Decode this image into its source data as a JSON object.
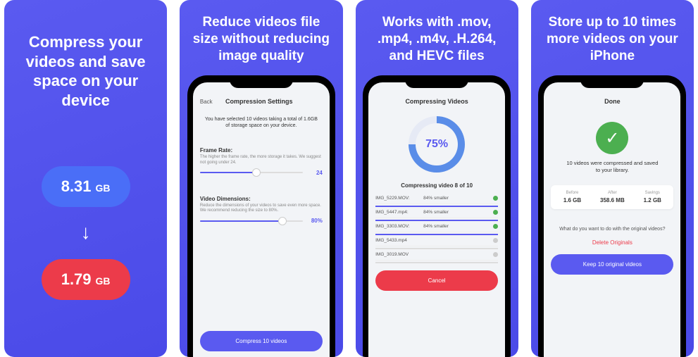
{
  "panel1": {
    "headline": "Compress your videos and save space on your device",
    "before_value": "8.31",
    "before_unit": "GB",
    "after_value": "1.79",
    "after_unit": "GB"
  },
  "panel2": {
    "headline": "Reduce videos file size without reducing image quality",
    "nav_back": "Back",
    "nav_title": "Compression Settings",
    "intro": "You have selected 10 videos taking a total of 1.6GB of storage space on your device.",
    "framerate_label": "Frame Rate:",
    "framerate_hint": "The higher the frame rate, the more storage it takes. We suggest not going under 24.",
    "framerate_value": "24",
    "dimensions_label": "Video Dimensions:",
    "dimensions_hint": "Reduce the dimensions of your videos to save even more space. We recommend reducing the size to 80%.",
    "dimensions_value": "80%",
    "cta": "Compress 10 videos"
  },
  "panel3": {
    "headline": "Works with .mov, .mp4, .m4v, .H.264, and HEVC files",
    "nav_title": "Compressing Videos",
    "progress_pct": "75%",
    "sub_label": "Compressing video 8 of 10",
    "rows": [
      {
        "name": "IMG_5229.MOV:",
        "stat": "84% smaller",
        "done": true
      },
      {
        "name": "IMG_5447.mp4:",
        "stat": "84% smaller",
        "done": true
      },
      {
        "name": "IMG_3303.MOV:",
        "stat": "84% smaller",
        "done": true
      },
      {
        "name": "IMG_5433.mp4",
        "stat": "",
        "done": false
      },
      {
        "name": "IMG_3019.MOV",
        "stat": "",
        "done": false
      }
    ],
    "cta": "Cancel"
  },
  "panel4": {
    "headline": "Store up to 10 times more videos on your iPhone",
    "nav_title": "Done",
    "done_text": "10 videos were compressed and saved to your library.",
    "stats": {
      "before_label": "Before",
      "before_value": "1.6 GB",
      "after_label": "After",
      "after_value": "358.6 MB",
      "savings_label": "Savings",
      "savings_value": "1.2 GB"
    },
    "prompt": "What do you want to do with the original videos?",
    "delete_link": "Delete Originals",
    "keep_btn": "Keep 10 original videos"
  }
}
